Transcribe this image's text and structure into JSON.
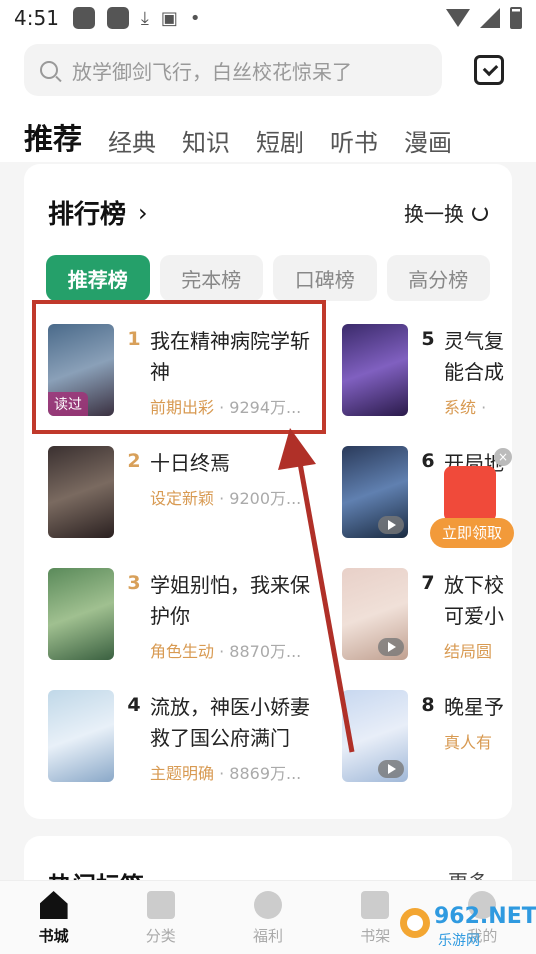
{
  "status_bar": {
    "time": "4:51"
  },
  "search": {
    "placeholder": "放学御剑飞行，白丝校花惊呆了"
  },
  "tabs": [
    {
      "label": "推荐",
      "active": true
    },
    {
      "label": "经典"
    },
    {
      "label": "知识"
    },
    {
      "label": "短剧"
    },
    {
      "label": "听书"
    },
    {
      "label": "漫画"
    }
  ],
  "ranking": {
    "title": "排行榜",
    "refresh_label": "换一换",
    "tabs": [
      "推荐榜",
      "完本榜",
      "口碑榜",
      "高分榜"
    ],
    "books": [
      {
        "rank": "1",
        "title": "我在精神病院学斩神",
        "tag": "前期出彩",
        "count": "9294万...",
        "badge": "读过"
      },
      {
        "rank": "2",
        "title": "十日终焉",
        "tag": "设定新颖",
        "count": "9200万..."
      },
      {
        "rank": "3",
        "title": "学姐别怕，我来保护你",
        "tag": "角色生动",
        "count": "8870万..."
      },
      {
        "rank": "4",
        "title": "流放，神医小娇妻救了国公府满门",
        "tag": "主题明确",
        "count": "8869万..."
      },
      {
        "rank": "5",
        "title": "灵气复能合成",
        "tag": "系统",
        "count": "·"
      },
      {
        "rank": "6",
        "title": "开局地",
        "tag": "",
        "count": ""
      },
      {
        "rank": "7",
        "title": "放下校可爱小",
        "tag": "结局圆",
        "count": ""
      },
      {
        "rank": "8",
        "title": "晚星予",
        "tag": "真人有",
        "count": ""
      }
    ]
  },
  "red_packet": {
    "button_label": "立即领取"
  },
  "hot_tags": {
    "title": "热门标签",
    "more_label": "更多"
  },
  "bottom_nav": [
    {
      "label": "书城",
      "active": true
    },
    {
      "label": "分类"
    },
    {
      "label": "福利"
    },
    {
      "label": "书架"
    },
    {
      "label": "我的"
    }
  ],
  "watermark": {
    "text": "962.NET",
    "sub": "乐游网"
  },
  "colors": {
    "accent_green": "#25a06a",
    "tag_gold": "#d89a52",
    "annotation_red": "#c0392b"
  }
}
